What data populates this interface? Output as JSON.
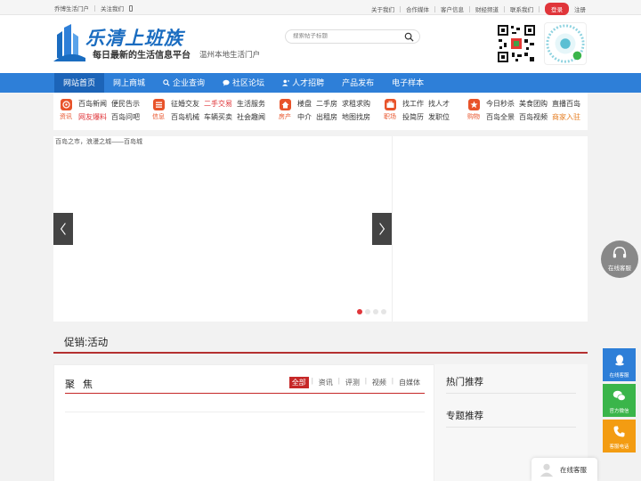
{
  "topbar": {
    "site_link": "乔博生活门户",
    "follow_link": "关注我们",
    "right_links": [
      "关于我们",
      "合作媒体",
      "客户信息",
      "财经频道",
      "联系我们"
    ],
    "login_label": "登录",
    "register_label": "注册"
  },
  "header": {
    "logo_title": "乐清上班族",
    "logo_subtitle": "每日最新的生活信息平台",
    "logo_city": "温州本地生活门户",
    "search_placeholder": "搜索帖子标题"
  },
  "nav": {
    "items": [
      {
        "label": "网站首页",
        "icon": ""
      },
      {
        "label": "网上商城",
        "icon": ""
      },
      {
        "label": "企业查询",
        "icon": "search-icon"
      },
      {
        "label": "社区论坛",
        "icon": "chat-icon"
      },
      {
        "label": "人才招聘",
        "icon": "user-add-icon"
      },
      {
        "label": "产品发布",
        "icon": ""
      },
      {
        "label": "电子样本",
        "icon": ""
      }
    ]
  },
  "categories": [
    {
      "label": "资讯",
      "links": [
        [
          "百岛新闻",
          "便民告示"
        ],
        [
          "网友爆料",
          "百岛问吧"
        ]
      ],
      "red": [
        "网友爆料"
      ]
    },
    {
      "label": "信息",
      "links": [
        [
          "征婚交友",
          "二手交易",
          "生活服务"
        ],
        [
          "百岛机械",
          "车辆买卖",
          "社会趣闻"
        ]
      ],
      "red": [
        "二手交易"
      ]
    },
    {
      "label": "房产",
      "links": [
        [
          "楼盘",
          "二手房",
          "求租求购"
        ],
        [
          "中介",
          "出租房",
          "地图找房"
        ]
      ],
      "red": []
    },
    {
      "label": "职场",
      "links": [
        [
          "找工作",
          "找人才"
        ],
        [
          "投简历",
          "发职位"
        ]
      ],
      "red": []
    },
    {
      "label": "购物",
      "links": [
        [
          "今日秒杀",
          "美食团购",
          "直播百岛"
        ],
        [
          "百岛全景",
          "百岛视频",
          "商家入驻"
        ]
      ],
      "orange": [
        "商家入驻"
      ]
    }
  ],
  "slider": {
    "caption": "百岛之市，浪漫之城——百岛城",
    "slide_count": 4,
    "active_slide": 1
  },
  "promo": {
    "title": "促销:活动"
  },
  "focus": {
    "title": "聚 焦",
    "tabs": [
      "全部",
      "资讯",
      "评测",
      "视频",
      "自媒体"
    ],
    "active_tab": "全部"
  },
  "side": {
    "hot_title": "热门推荐",
    "topic_title": "专题推荐"
  },
  "floating": {
    "cs_label": "在线客服",
    "tools": [
      "在线客服",
      "官方微信",
      "客服电话"
    ],
    "bottom_label": "在线客服"
  },
  "colors": {
    "brand_blue": "#2e7fd8",
    "accent_red": "#e0353a",
    "badge_orange": "#e8532a"
  }
}
